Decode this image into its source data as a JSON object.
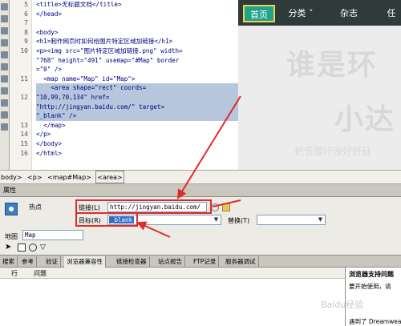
{
  "editor": {
    "line_numbers": [
      "5",
      "6",
      "7",
      "8",
      "9",
      "10",
      "",
      "",
      "11",
      "",
      "12",
      "",
      "",
      "13",
      "14",
      "15",
      "16",
      ""
    ],
    "lines": [
      {
        "text": "<title>无标题文档</title>",
        "selected": false
      },
      {
        "text": "</head>",
        "selected": false
      },
      {
        "text": "",
        "selected": false
      },
      {
        "text": "<body>",
        "selected": false
      },
      {
        "text": "<h1>制作网页时如何给图片特定区域加链接</h1>",
        "selected": false
      },
      {
        "text": "<p><img src=\"图片特定区域加链接.png\" width=",
        "selected": false
      },
      {
        "text": "\"768\" height=\"491\" usemap=\"#Map\" border",
        "selected": false
      },
      {
        "text": "=\"0\" />",
        "selected": false
      },
      {
        "text": "  <map name=\"Map\" id=\"Map\">",
        "selected": false
      },
      {
        "text": "    <area shape=\"rect\" coords=",
        "selected": true
      },
      {
        "text": "\"10,99,70,134\" href=",
        "selected": true
      },
      {
        "text": "\"http://jingyan.baidu.com/\" target=",
        "selected": true
      },
      {
        "text": "\"_blank\" />",
        "selected": true
      },
      {
        "text": "  </map>",
        "selected": false
      },
      {
        "text": "</p>",
        "selected": false
      },
      {
        "text": "</body>",
        "selected": false
      },
      {
        "text": "</html>",
        "selected": false
      },
      {
        "text": "",
        "selected": false
      }
    ]
  },
  "preview": {
    "nav": {
      "home": "首页",
      "category": "分类",
      "magazine": "杂志",
      "task": "任"
    },
    "watermark_big": "谁是环",
    "watermark_mid": "小达",
    "watermark_small": "把低碳环保好好延"
  },
  "tagbar": {
    "items": [
      "body>",
      "<p>",
      "<map#Map>",
      "<area>"
    ]
  },
  "properties": {
    "title": "属性",
    "hotspot_label": "热点",
    "link_label": "链接(L)",
    "link_value": "http://jingyan.baidu.com/",
    "target_label": "目标(R)",
    "target_value": "_blank",
    "replace_label": "替换(T)",
    "map_label": "地图",
    "map_value": "Map"
  },
  "tabs": [
    "搜索",
    "参考",
    "验证",
    "浏览器兼容性",
    "链接检查器",
    "站点报告",
    "FTP记录",
    "服务器调试"
  ],
  "active_tab": 3,
  "results": {
    "col_row": "行",
    "col_issue": "问题"
  },
  "side_panel": {
    "title": "浏览器支持问题",
    "text": "要开始使用，请",
    "footer": "遇到了 Dreamwea"
  },
  "watermark_footer": "Baidu经验",
  "colors": {
    "selection": "#b6c6dc",
    "red_annotation": "#e02a2a",
    "nav_active": "#1ea38d",
    "nav_border": "#f3d24a"
  }
}
